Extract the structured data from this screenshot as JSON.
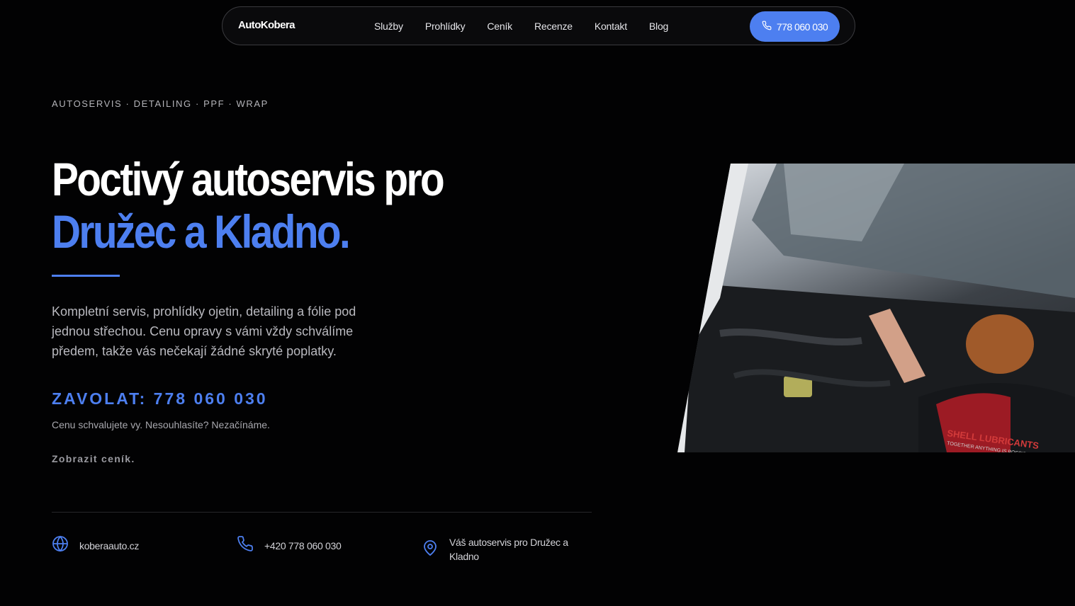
{
  "brand": "AutoKobera",
  "nav": {
    "items": [
      "Služby",
      "Prohlídky",
      "Ceník",
      "Recenze",
      "Kontakt",
      "Blog"
    ],
    "phone_cta": "778 060 030",
    "phone_icon": "phone-icon"
  },
  "hero": {
    "eyebrow": "AUTOSERVIS · DETAILING · PPF · WRAP",
    "title_line1": "Poctivý autoservis pro",
    "title_line2": "Družec a Kladno.",
    "lead": "Kompletní servis, prohlídky ojetin, detailing a fólie pod jednou střechou. Cenu opravy s vámi vždy schválíme předem, takže vás nečekají žádné skryté poplatky.",
    "call_cta": "ZAVOLAT: 778 060 030",
    "note": "Cenu schvalujete vy. Nesouhlasíte? Nezačínáme.",
    "pricing_link": "Zobrazit ceník.",
    "accent_color": "#4d7ff0",
    "image_text": "SHELL LUBRICANTS",
    "image_subtext": "TOGETHER ANYTHING IS POSSIBLE"
  },
  "contact": {
    "website": "koberaauto.cz",
    "website_icon": "globe-icon",
    "phone": "+420 778 060 030",
    "phone_icon": "phone-icon",
    "location": "Váš autoservis pro Družec a Kladno",
    "location_icon": "map-pin-icon"
  }
}
